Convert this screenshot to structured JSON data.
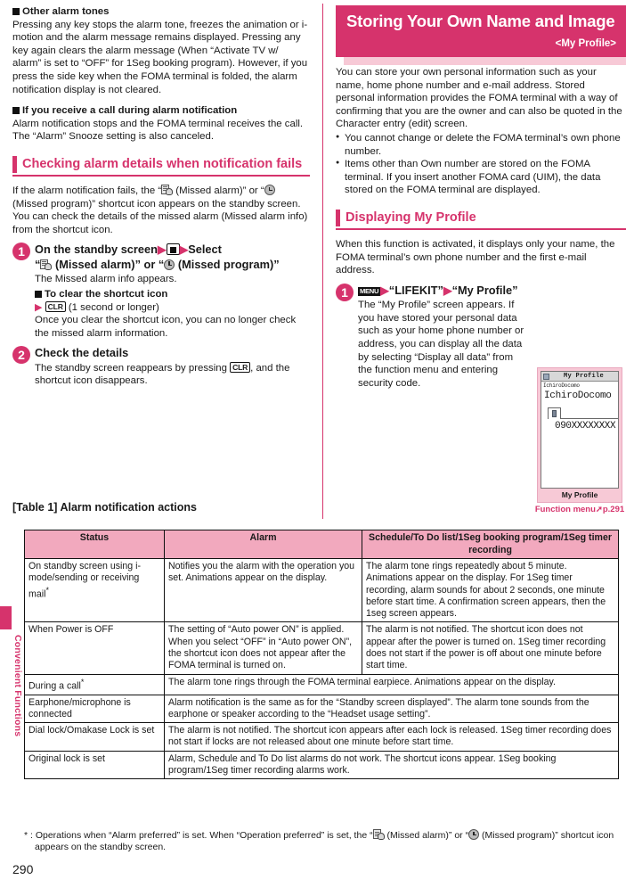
{
  "page_number": "290",
  "side_tab": {
    "label": "Convenient Functions"
  },
  "left_column": {
    "sub1": {
      "heading": "Other alarm tones",
      "body": "Pressing any key stops the alarm tone, freezes the animation or i-motion and the alarm message remains displayed. Pressing any key again clears the alarm message (When “Activate TV w/ alarm” is set to “OFF” for 1Seg booking program). However, if you press the side key when the FOMA terminal is folded, the alarm notification display is not cleared."
    },
    "sub2": {
      "heading": "If you receive a call during alarm notification",
      "body": "Alarm notification stops and the FOMA terminal receives the call. The “Alarm” Snooze setting is also canceled."
    },
    "section": {
      "title": "Checking alarm details when notification fails"
    },
    "intro_a": "If the alarm notification fails, the “",
    "intro_b": " (Missed alarm)” or “",
    "intro_c": " (Missed program)” shortcut icon appears on the standby screen. You can check the details of the missed alarm (Missed alarm info) from the shortcut icon.",
    "step1": {
      "num": "1",
      "head_a": "On the standby screen",
      "head_b": "Select",
      "head_c": "“",
      "head_d": " (Missed alarm)” or “",
      "head_e": " (Missed program)”",
      "body1": "The Missed alarm info appears.",
      "sub_head": "To clear the shortcut icon",
      "key_clr": "CLR",
      "sub_line": "(1 second or longer)",
      "body2": "Once you clear the shortcut icon, you can no longer check the missed alarm information."
    },
    "step2": {
      "num": "2",
      "head": "Check the details",
      "body_a": "The standby screen reappears by pressing ",
      "key_clr": "CLR",
      "body_b": ", and the shortcut icon disappears."
    }
  },
  "right_column": {
    "banner": {
      "title": "Storing Your Own Name and Image",
      "subtitle": "<My Profile>"
    },
    "intro": "You can store your own personal information such as your name, home phone number and e-mail address. Stored personal information provides the FOMA terminal with a way of confirming that you are the owner and can also be quoted in the Character entry (edit) screen.",
    "bullets": [
      "You cannot change or delete the FOMA terminal’s own phone number.",
      "Items other than Own number are stored on the FOMA terminal. If you insert another FOMA card (UIM), the data stored on the FOMA terminal are displayed."
    ],
    "section": {
      "title": "Displaying My Profile"
    },
    "intro2": "When this function is activated, it displays only your name, the FOMA terminal’s own phone number and the first e-mail address.",
    "step1": {
      "num": "1",
      "key_menu": "MENU",
      "head_a": "“LIFEKIT”",
      "head_b": "“My Profile”",
      "body": "The “My Profile” screen appears. If you have stored your personal data such as your home phone number or address, you can display all the data by selecting “Display all data” from the function menu and entering security code."
    },
    "phone": {
      "title": "My Profile",
      "small_name": "IchiroDocomo",
      "name": "IchiroDocomo",
      "number": "090XXXXXXXX",
      "caption": "My Profile",
      "function_menu": "Function menu➚p.291"
    }
  },
  "table": {
    "caption": "[Table 1] Alarm notification actions",
    "headers": [
      "Status",
      "Alarm",
      "Schedule/To Do list/1Seg booking program/1Seg timer recording"
    ],
    "rows": [
      {
        "status": "On standby screen using i-mode/sending or receiving mail",
        "status_ast": "*",
        "alarm": "Notifies you the alarm with the operation you set. Animations appear on the display.",
        "schedule": "The alarm tone rings repeatedly about 5 minute. Animations appear on the display. For 1Seg timer recording, alarm sounds for about 2 seconds, one minute before start time. A confirmation screen appears, then the 1seg screen appears.",
        "span": false
      },
      {
        "status": "When Power is OFF",
        "status_ast": "",
        "alarm": "The setting of “Auto power ON” is applied. When you select “OFF” in “Auto power ON”, the shortcut icon does not appear after the FOMA terminal is turned on.",
        "schedule": "The alarm is not notified. The shortcut icon does not appear after the power is turned on. 1Seg timer recording does not start if the power is off about one minute before start time.",
        "span": false
      },
      {
        "status": "During a call",
        "status_ast": "*",
        "merged": "The alarm tone rings through the FOMA terminal earpiece. Animations appear on the display.",
        "span": true
      },
      {
        "status": "Earphone/microphone is connected",
        "status_ast": "",
        "merged": "Alarm notification is the same as for the “Standby screen displayed”. The alarm tone sounds from the earphone or speaker according to the “Headset usage setting”.",
        "span": true
      },
      {
        "status": "Dial lock/Omakase Lock is set",
        "status_ast": "",
        "merged": "The alarm is not notified. The shortcut icon appears after each lock is released. 1Seg timer recording does not start if locks are not released about one minute before start time.",
        "span": true
      },
      {
        "status": "Original lock is set",
        "status_ast": "",
        "merged": "Alarm, Schedule and To Do list alarms do not work. The shortcut icons appear. 1Seg booking program/1Seg timer recording alarms work.",
        "span": true
      }
    ]
  },
  "footnote": {
    "a": "* : Operations when “Alarm preferred” is set. When “Operation preferred” is set, the “",
    "b": " (Missed alarm)” or “",
    "c": " (Missed program)” shortcut icon appears on the standby screen."
  },
  "colors": {
    "accent": "#d6336c",
    "header_fill": "#f2a9be",
    "banner_shadow": "#f7c9d6"
  }
}
